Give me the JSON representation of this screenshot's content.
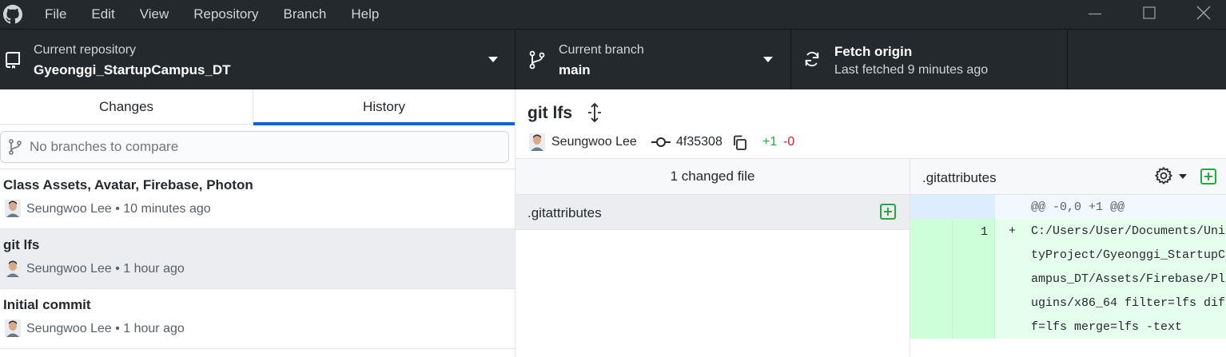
{
  "menu": {
    "items": [
      "File",
      "Edit",
      "View",
      "Repository",
      "Branch",
      "Help"
    ]
  },
  "toolbar": {
    "repository_label": "Current repository",
    "repository_name": "Gyeonggi_StartupCampus_DT",
    "branch_label": "Current branch",
    "branch_name": "main",
    "fetch_title": "Fetch origin",
    "fetch_status": "Last fetched 9 minutes ago"
  },
  "sidebar": {
    "tabs": [
      "Changes",
      "History"
    ],
    "selected_tab": "History",
    "compare_placeholder": "No branches to compare",
    "commits": [
      {
        "title": "Class Assets, Avatar, Firebase, Photon",
        "meta": "Seungwoo Lee • 10 minutes ago",
        "selected": false
      },
      {
        "title": "git lfs",
        "meta": "Seungwoo Lee • 1 hour ago",
        "selected": true
      },
      {
        "title": "Initial commit",
        "meta": "Seungwoo Lee • 1 hour ago",
        "selected": false
      }
    ]
  },
  "commit_detail": {
    "title": "git lfs",
    "author": "Seungwoo Lee",
    "sha": "4f35308",
    "additions": "+1",
    "deletions": "-0"
  },
  "files": {
    "header": "1 changed file",
    "items": [
      ".gitattributes"
    ]
  },
  "diff": {
    "filename": ".gitattributes",
    "hunk": "@@ -0,0 +1 @@",
    "line_number": "1",
    "marker": "+",
    "lines": [
      "C:/Users/User/Documents/Uni",
      "tyProject/Gyeonggi_StartupC",
      "ampus_DT/Assets/Firebase/Pl",
      "ugins/x86_64 filter=lfs dif",
      "f=lfs merge=lfs -text"
    ]
  },
  "colors": {
    "dark_bg": "#24292e",
    "accent": "#0366d6",
    "addition_green": "#28a745",
    "deletion_red": "#cb2431",
    "diff_added_bg": "#e6ffed",
    "diff_added_gutter": "#cdffd8"
  }
}
